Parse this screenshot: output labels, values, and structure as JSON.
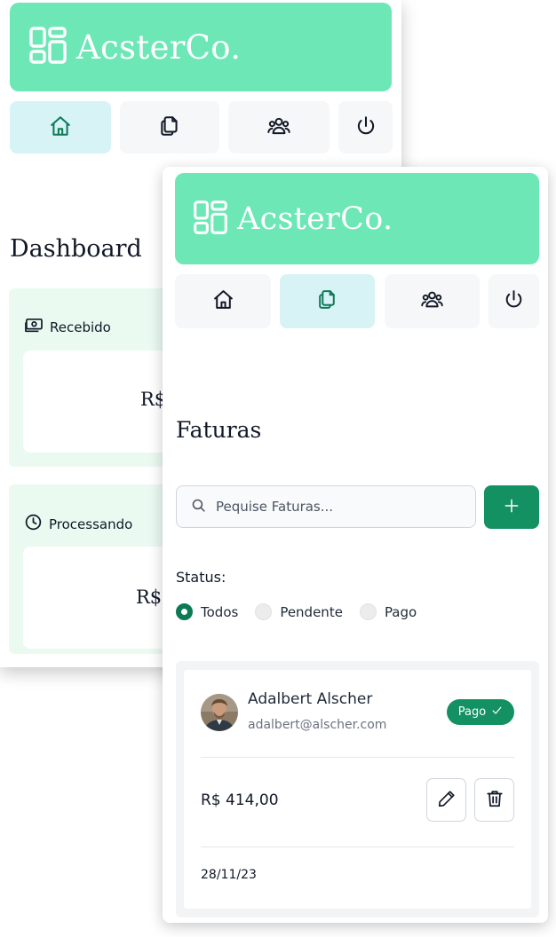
{
  "back_screen": {
    "brand": {
      "name": "AcsterCo."
    },
    "nav": [
      "home-icon",
      "invoices-icon",
      "users-icon",
      "power-icon"
    ],
    "nav_active": "home",
    "page_title": "Dashboard",
    "cards": [
      {
        "label": "Recebido",
        "icon": "cash-icon",
        "value": "R$"
      },
      {
        "label": "Processando",
        "icon": "clock-icon",
        "value": "R$"
      }
    ]
  },
  "front_screen": {
    "brand": {
      "name": "AcsterCo."
    },
    "nav": [
      "home-icon",
      "invoices-icon",
      "users-icon",
      "power-icon"
    ],
    "nav_active": "invoices",
    "page_title": "Faturas",
    "search": {
      "placeholder": "Pequise Faturas..."
    },
    "add_button": {
      "label": "+"
    },
    "status": {
      "label": "Status:",
      "options": [
        "Todos",
        "Pendente",
        "Pago"
      ],
      "selected": "Todos"
    },
    "invoice": {
      "name": "Adalbert Alscher",
      "email": "adalbert@alscher.com",
      "status": "Pago",
      "amount": "R$ 414,00",
      "date": "28/11/23"
    }
  },
  "colors": {
    "brand": "#6ee7b7",
    "active_nav": "#d7f3f5",
    "accent": "#149163",
    "card_bg": "#eafaf1"
  }
}
